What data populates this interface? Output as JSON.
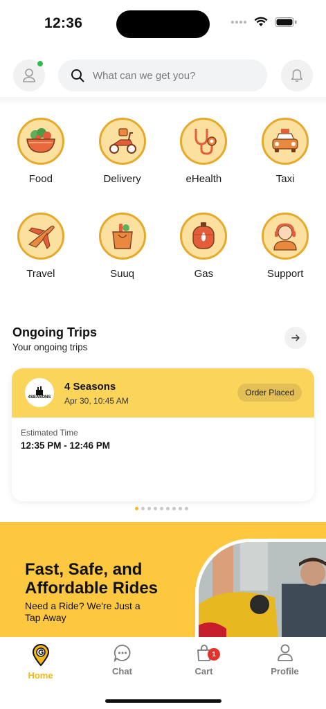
{
  "status_bar": {
    "time": "12:36"
  },
  "header": {
    "search_placeholder": "What can we get you?"
  },
  "categories": [
    {
      "label": "Food",
      "icon": "salad-bowl-icon"
    },
    {
      "label": "Delivery",
      "icon": "scooter-icon"
    },
    {
      "label": "eHealth",
      "icon": "stethoscope-icon"
    },
    {
      "label": "Taxi",
      "icon": "taxi-icon"
    },
    {
      "label": "Travel",
      "icon": "airplane-icon"
    },
    {
      "label": "Suuq",
      "icon": "shopping-bag-icon"
    },
    {
      "label": "Gas",
      "icon": "gas-cylinder-icon"
    },
    {
      "label": "Support",
      "icon": "support-agent-icon"
    }
  ],
  "ongoing": {
    "title": "Ongoing Trips",
    "subtitle": "Your ongoing trips",
    "trip": {
      "store_name": "4 Seasons",
      "logo_text": "4SEASONS",
      "date": "Apr 30, 10:45 AM",
      "status": "Order Placed",
      "estimated_label": "Estimated Time",
      "estimated_value": "12:35 PM - 12:46 PM"
    },
    "pagination": {
      "total": 9,
      "active_index": 0
    }
  },
  "banner": {
    "title": "Fast, Safe, and Affordable Rides",
    "subtitle": "Need a Ride? We're Just a Tap Away"
  },
  "tabbar": {
    "home": "Home",
    "chat": "Chat",
    "cart": "Cart",
    "cart_badge": "1",
    "profile": "Profile"
  },
  "colors": {
    "accent": "#f5b817",
    "banner": "#fdc83f",
    "card_header": "#fbd55a",
    "online": "#2ebd4e",
    "badge": "#e5322b"
  }
}
